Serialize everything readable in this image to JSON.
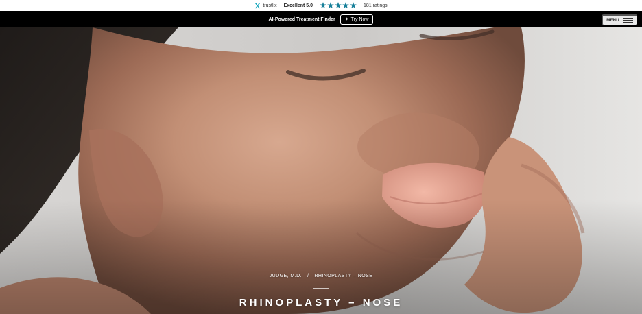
{
  "ratings": {
    "brand": "trustlix",
    "label": "Excellent 5.0",
    "stars_value": 5,
    "count": "181 ratings"
  },
  "promo": {
    "text": "AI-Powered Treatment Finder",
    "button_label": "Try Now",
    "button_icon": "sparkle-icon"
  },
  "menu": {
    "label": "MENU",
    "icon": "hamburger-icon"
  },
  "hero": {
    "breadcrumb": [
      "JUDGE, M.D.",
      "/",
      "RHINOPLASTY – NOSE"
    ],
    "title": "RHINOPLASTY – NOSE"
  }
}
